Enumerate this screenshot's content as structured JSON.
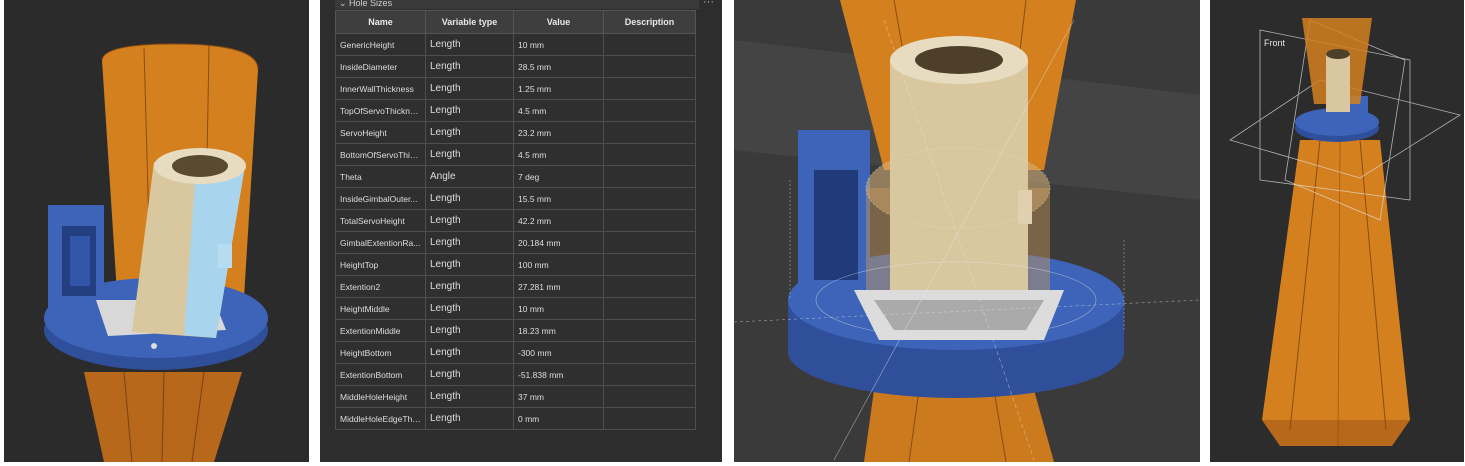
{
  "table_panel": {
    "title": "Hole Sizes",
    "menu_glyph": "···",
    "columns": [
      "Name",
      "Variable type",
      "Value",
      "Description"
    ],
    "rows": [
      {
        "name": "GenericHeight",
        "type": "Length",
        "value": "10 mm",
        "description": ""
      },
      {
        "name": "InsideDiameter",
        "type": "Length",
        "value": "28.5 mm",
        "description": ""
      },
      {
        "name": "InnerWallThickness",
        "type": "Length",
        "value": "1.25 mm",
        "description": ""
      },
      {
        "name": "TopOfServoThickne...",
        "type": "Length",
        "value": "4.5 mm",
        "description": ""
      },
      {
        "name": "ServoHeight",
        "type": "Length",
        "value": "23.2 mm",
        "description": ""
      },
      {
        "name": "BottomOfServoThic...",
        "type": "Length",
        "value": "4.5 mm",
        "description": ""
      },
      {
        "name": "Theta",
        "type": "Angle",
        "value": "7 deg",
        "description": ""
      },
      {
        "name": "InsideGimbalOuter...",
        "type": "Length",
        "value": "15.5 mm",
        "description": ""
      },
      {
        "name": "TotalServoHeight",
        "type": "Length",
        "value": "42.2 mm",
        "description": ""
      },
      {
        "name": "GimbalExtentionRa...",
        "type": "Length",
        "value": "20.184 mm",
        "description": ""
      },
      {
        "name": "HeightTop",
        "type": "Length",
        "value": "100 mm",
        "description": ""
      },
      {
        "name": "Extention2",
        "type": "Length",
        "value": "27.281 mm",
        "description": ""
      },
      {
        "name": "HeightMiddle",
        "type": "Length",
        "value": "10 mm",
        "description": ""
      },
      {
        "name": "ExtentionMiddle",
        "type": "Length",
        "value": "18.23 mm",
        "description": ""
      },
      {
        "name": "HeightBottom",
        "type": "Length",
        "value": "-300 mm",
        "description": ""
      },
      {
        "name": "ExtentionBottom",
        "type": "Length",
        "value": "-51.838 mm",
        "description": ""
      },
      {
        "name": "MiddleHoleHeight",
        "type": "Length",
        "value": "37 mm",
        "description": ""
      },
      {
        "name": "MiddleHoleEdgeThi...",
        "type": "Length",
        "value": "0 mm",
        "description": ""
      }
    ]
  },
  "viewport4": {
    "plane_label": "Front"
  },
  "colors": {
    "orange": "#d4801f",
    "blue": "#3d64b8",
    "tan": "#d9c7a0",
    "light_blue": "#a9d4ee",
    "background": "#2b2b2b"
  }
}
